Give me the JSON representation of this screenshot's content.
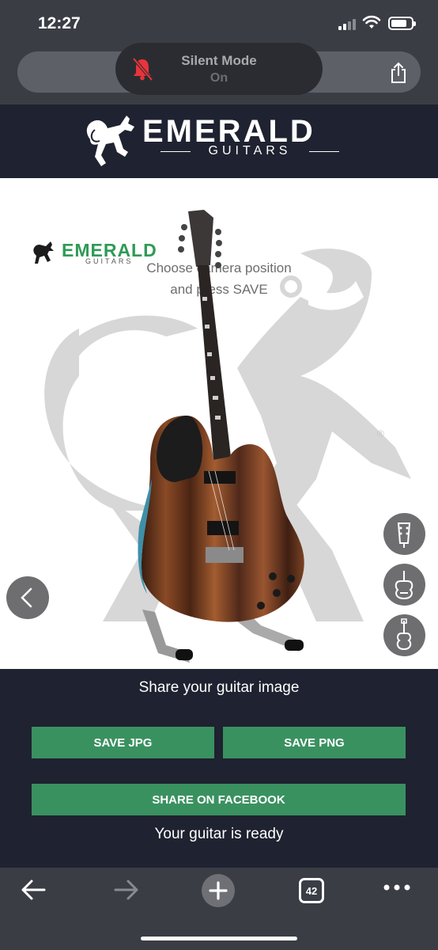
{
  "status_bar": {
    "time": "12:27"
  },
  "silent_mode": {
    "title": "Silent Mode",
    "state": "On"
  },
  "brand": {
    "name": "EMERALD",
    "sub": "GUITARS"
  },
  "viewer": {
    "mini_logo_name": "EMERALD",
    "mini_logo_sub": "GUITARS",
    "hint": "Choose camera position and press SAVE",
    "registered": "®"
  },
  "share": {
    "heading": "Share your guitar image",
    "save_jpg": "SAVE JPG",
    "save_png": "SAVE PNG",
    "facebook": "SHARE ON FACEBOOK",
    "ready": "Your guitar is ready"
  },
  "toolbar": {
    "tab_count": "42"
  },
  "colors": {
    "accent_green": "#3a9160",
    "header_bg": "#1f2230",
    "chrome_bg": "#3b3d45"
  }
}
